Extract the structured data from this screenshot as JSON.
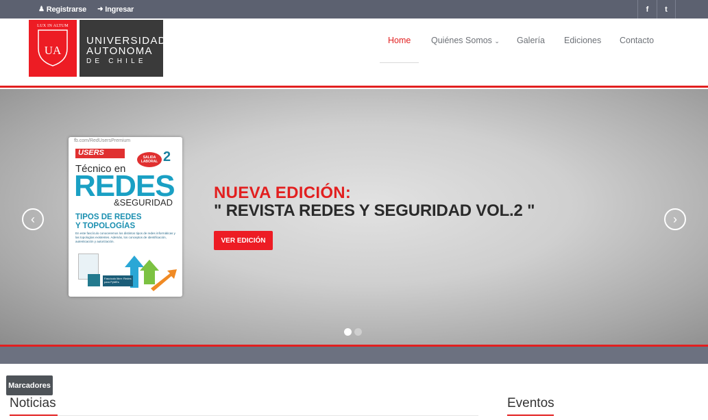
{
  "topbar": {
    "register_icon": "user-icon",
    "register_label": "Registrarse",
    "login_icon": "sign-in-icon",
    "login_label": "Ingresar",
    "facebook_label": "f",
    "twitter_label": "t"
  },
  "logo": {
    "motto": "LUX IN ALTUM",
    "initials": "UA",
    "line1": "UNIVERSIDAD",
    "line2": "AUTONOMA",
    "line3": "DE CHILE"
  },
  "nav": {
    "items": [
      {
        "label": "Home",
        "active": true
      },
      {
        "label": "Quiénes Somos",
        "dropdown": true
      },
      {
        "label": "Galería"
      },
      {
        "label": "Ediciones"
      },
      {
        "label": "Contacto"
      }
    ]
  },
  "slider": {
    "magazine": {
      "top_text": "fb.com/RedUsersPremium",
      "brand": "USERS",
      "badge": "SALIDA LABORAL",
      "number": "2",
      "tecnico": "Técnico en",
      "redes": "REDES",
      "seguridad": "&SEGURIDAD",
      "tipos_line1": "TIPOS DE REDES",
      "tipos_line2": "Y TOPOLOGÍAS",
      "description": "En este fascículo conoceremos los distintos tipos de redes informáticas y las topologías existentes. Además, los conceptos de identificación, autenticación y autorización.",
      "caption": "Fascículo libre: Redes para PyMEs"
    },
    "title_line1": "NUEVA EDICIÓN:",
    "title_line2": "\" REVISTA REDES Y SEGURIDAD VOL.2 \"",
    "button_label": "VER EDICIÓN",
    "prev_icon": "chevron-left-icon",
    "next_icon": "chevron-right-icon",
    "slide_count": 2,
    "active_slide": 1
  },
  "marcadores_label": "Marcadores",
  "sections": {
    "noticias": "Noticias",
    "eventos": "Eventos"
  },
  "colors": {
    "accent": "#e21f1f",
    "topbar": "#5c6170",
    "band": "#6c7180"
  }
}
